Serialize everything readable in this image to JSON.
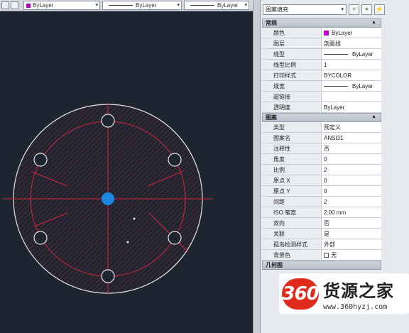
{
  "toolbar": {
    "color_value": "ByLayer",
    "linetype_value": "ByLayer",
    "lineweight_value": "ByLayer"
  },
  "palette": {
    "object_type": "图案填充",
    "sections": [
      {
        "title": "常规",
        "rows": [
          {
            "key": "颜色",
            "value": "ByLayer",
            "swatch": "#c000c8"
          },
          {
            "key": "图层",
            "value": "剖面线"
          },
          {
            "key": "线型",
            "value": "ByLayer",
            "line": true
          },
          {
            "key": "线型比例",
            "value": "1"
          },
          {
            "key": "打印样式",
            "value": "BYCOLOR"
          },
          {
            "key": "线宽",
            "value": "ByLayer",
            "line": true
          },
          {
            "key": "超链接",
            "value": ""
          },
          {
            "key": "透明度",
            "value": "ByLayer"
          }
        ]
      },
      {
        "title": "图案",
        "rows": [
          {
            "key": "类型",
            "value": "预定义"
          },
          {
            "key": "图案名",
            "value": "ANSI31"
          },
          {
            "key": "注释性",
            "value": "否"
          },
          {
            "key": "角度",
            "value": "0"
          },
          {
            "key": "比例",
            "value": "2"
          },
          {
            "key": "原点 X",
            "value": "0"
          },
          {
            "key": "原点 Y",
            "value": "0"
          },
          {
            "key": "间距",
            "value": "2"
          },
          {
            "key": "ISO 笔宽",
            "value": "2.00 mm"
          },
          {
            "key": "双向",
            "value": "否"
          },
          {
            "key": "关联",
            "value": "是"
          },
          {
            "key": "孤岛检测样式",
            "value": "外部"
          },
          {
            "key": "背景色",
            "value": "无",
            "checkbox": true
          }
        ]
      }
    ],
    "partial_section_title": "几何图"
  },
  "logo": {
    "badge": "360",
    "name": "货源之家",
    "url": "www.360hyzj.com"
  },
  "colors": {
    "canvas": "#1d2531",
    "circle": "#e8e8e8",
    "centerline": "#d0283a",
    "center_dot": "#1e88e5",
    "hatch": "#c0283a"
  }
}
